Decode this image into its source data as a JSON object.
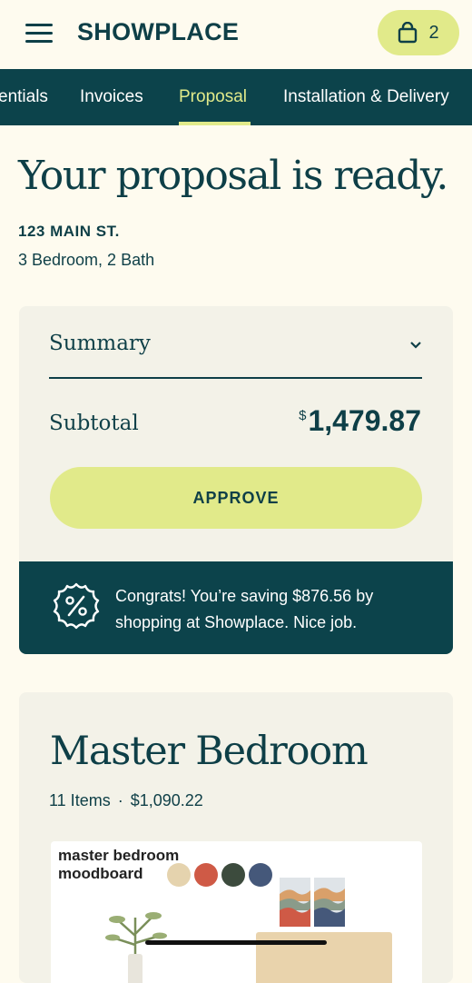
{
  "header": {
    "logo": "SHOWPLACE",
    "cart_count": "2",
    "menu_icon": "hamburger-menu-icon",
    "cart_icon": "shopping-bag-icon"
  },
  "tabs": [
    {
      "label": "Essentials",
      "visible_label": "entials"
    },
    {
      "label": "Invoices"
    },
    {
      "label": "Proposal",
      "active": true
    },
    {
      "label": "Installation & Delivery"
    }
  ],
  "proposal": {
    "title": "Your proposal is ready.",
    "address": "123 MAIN ST.",
    "details": "3 Bedroom, 2 Bath"
  },
  "summary": {
    "label": "Summary",
    "subtotal_label": "Subtotal",
    "currency": "$",
    "subtotal_value": "1,479.87",
    "approve_label": "APPROVE",
    "savings_text": "Congrats! You’re saving $876.56 by shopping at Showplace. Nice job.",
    "savings_icon": "percent-badge-icon"
  },
  "room": {
    "title": "Master Bedroom",
    "items": "11 Items",
    "separator": "·",
    "price": "$1,090.22",
    "moodboard_label": "master bedroom moodboard"
  },
  "colors": {
    "brand_dark": "#0c434b",
    "accent": "#e1ea8a",
    "background": "#fefbef",
    "card": "#f3f2e8",
    "swatches": [
      "#e5d3ae",
      "#cf5a46",
      "#3c4b3d",
      "#45587a"
    ]
  }
}
